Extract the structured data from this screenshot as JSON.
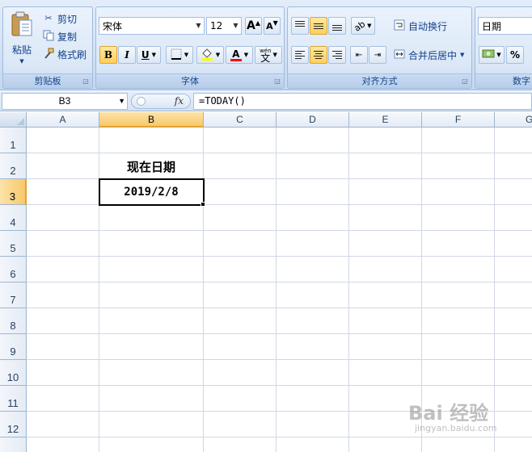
{
  "clipboard": {
    "paste_label": "粘贴",
    "cut_label": "剪切",
    "copy_label": "复制",
    "format_painter_label": "格式刷",
    "group_label": "剪贴板"
  },
  "font": {
    "font_name": "宋体",
    "font_size": "12",
    "grow_label": "A",
    "shrink_label": "A",
    "bold_label": "B",
    "italic_label": "I",
    "underline_label": "U",
    "font_color_label": "A",
    "phonetic_label": "文",
    "group_label": "字体"
  },
  "alignment": {
    "wrap_text_label": "自动换行",
    "merge_center_label": "合并后居中",
    "group_label": "对齐方式"
  },
  "number": {
    "format_value": "日期",
    "percent_label": "%",
    "group_label": "数字"
  },
  "formula_bar": {
    "name_box": "B3",
    "fx_label": "fx",
    "formula": "=TODAY()"
  },
  "sheet": {
    "columns": [
      "A",
      "B",
      "C",
      "D",
      "E",
      "F",
      "G"
    ],
    "rows": [
      "1",
      "2",
      "3",
      "4",
      "5",
      "6",
      "7",
      "8",
      "9",
      "10",
      "11",
      "12"
    ],
    "selected_cell": "B3",
    "cells": {
      "B2": "现在日期",
      "B3": "2019/2/8"
    }
  },
  "watermark": {
    "brand": "Bai  经验",
    "url": "jingyan.baidu.com"
  },
  "colors": {
    "ribbon_bg": "#d2e1f4",
    "header_selected": "#f8c86a",
    "grid_line": "#d0d7e5",
    "label_text": "#15428b"
  }
}
